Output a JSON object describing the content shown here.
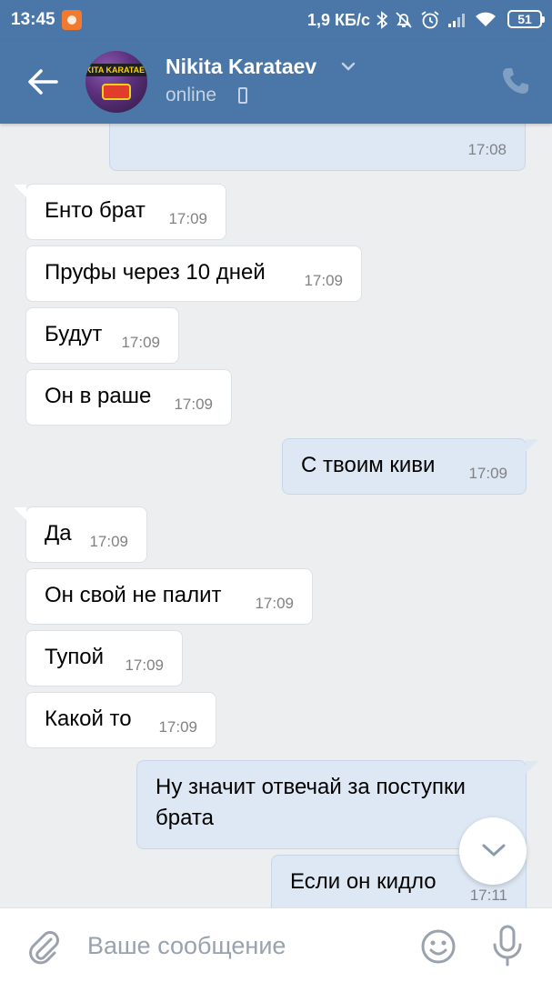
{
  "status_bar": {
    "time": "13:45",
    "speed": "1,9 КБ/с",
    "battery": "51",
    "icons": [
      "bluetooth-icon",
      "alarm-off-icon",
      "alarm-icon",
      "signal-icon",
      "wifi-icon"
    ]
  },
  "header": {
    "name": "Nikita Karataev",
    "status": "online",
    "avatar_text": "KITA KARATAEV"
  },
  "messages": [
    {
      "dir": "out",
      "text": "",
      "time": "17:08"
    },
    {
      "dir": "in",
      "text": "Енто брат",
      "time": "17:09"
    },
    {
      "dir": "in",
      "text": "Пруфы через 10 дней",
      "time": "17:09"
    },
    {
      "dir": "in",
      "text": "Будут",
      "time": "17:09"
    },
    {
      "dir": "in",
      "text": "Он в раше",
      "time": "17:09"
    },
    {
      "dir": "out",
      "text": "С твоим киви",
      "time": "17:09"
    },
    {
      "dir": "in",
      "text": "Да",
      "time": "17:09"
    },
    {
      "dir": "in",
      "text": "Он свой не палит",
      "time": "17:09"
    },
    {
      "dir": "in",
      "text": "Тупой",
      "time": "17:09"
    },
    {
      "dir": "in",
      "text": "Какой то",
      "time": "17:09"
    },
    {
      "dir": "out",
      "text_line1": "Ну значит отвечай за поступки",
      "text_line2": "брата",
      "time": ""
    },
    {
      "dir": "out",
      "text": "Если он кидло",
      "time": "17:11"
    }
  ],
  "composer": {
    "placeholder": "Ваше сообщение"
  },
  "colors": {
    "header": "#4a76a8",
    "chat_bg": "#edeef0",
    "incoming": "#ffffff",
    "outgoing": "#dde8f4"
  }
}
